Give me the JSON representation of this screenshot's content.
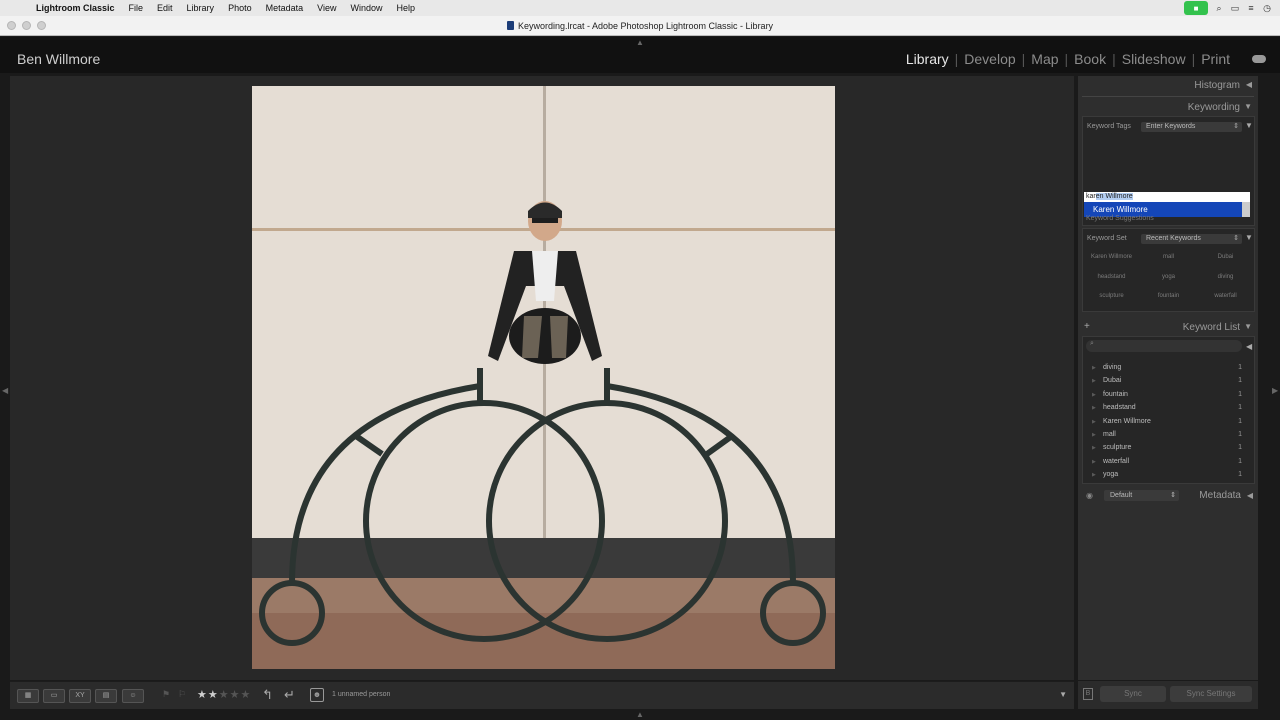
{
  "menubar": {
    "app": "Lightroom Classic",
    "items": [
      "File",
      "Edit",
      "Library",
      "Photo",
      "Metadata",
      "View",
      "Window",
      "Help"
    ]
  },
  "window": {
    "title": "Keywording.lrcat - Adobe Photoshop Lightroom Classic - Library"
  },
  "identity": {
    "owner": "Ben Willmore"
  },
  "modules": [
    "Library",
    "Develop",
    "Map",
    "Book",
    "Slideshow",
    "Print"
  ],
  "right_panel": {
    "histogram": "Histogram",
    "keywording": {
      "title": "Keywording",
      "keyword_tags_label": "Keyword Tags",
      "keyword_tags_value": "Enter Keywords",
      "input_typed": "kar",
      "input_completion": "en Willmore",
      "suggestion": "Karen Willmore",
      "suggestions_label": "Keyword Suggestions",
      "keyword_set_label": "Keyword Set",
      "keyword_set_value": "Recent Keywords",
      "set_keywords": [
        "Karen Willmore",
        "mall",
        "Dubai",
        "headstand",
        "yoga",
        "diving",
        "sculpture",
        "fountain",
        "waterfall"
      ]
    },
    "keyword_list": {
      "title": "Keyword List",
      "add": "+",
      "items": [
        {
          "name": "diving",
          "count": "1"
        },
        {
          "name": "Dubai",
          "count": "1"
        },
        {
          "name": "fountain",
          "count": "1"
        },
        {
          "name": "headstand",
          "count": "1"
        },
        {
          "name": "Karen Willmore",
          "count": "1"
        },
        {
          "name": "mall",
          "count": "1"
        },
        {
          "name": "sculpture",
          "count": "1"
        },
        {
          "name": "waterfall",
          "count": "1"
        },
        {
          "name": "yoga",
          "count": "1"
        }
      ]
    },
    "metadata": {
      "title": "Metadata",
      "preset": "Default"
    }
  },
  "toolbar": {
    "rating": 2,
    "people": "1 unnamed person"
  },
  "sync": {
    "sync": "Sync",
    "sync_settings": "Sync Settings"
  }
}
